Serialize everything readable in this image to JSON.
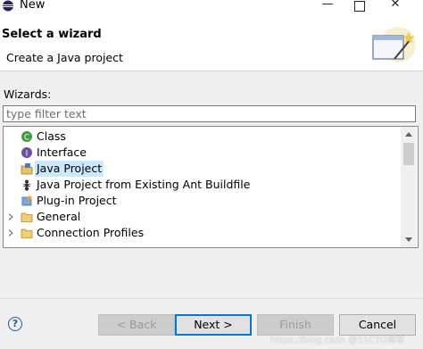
{
  "window": {
    "title": "New"
  },
  "header": {
    "title": "Select a wizard",
    "description": "Create a Java project"
  },
  "filter": {
    "label": "Wizards:",
    "placeholder": "type filter text"
  },
  "tree": {
    "items": [
      {
        "label": "Class",
        "icon": "class-icon",
        "expandable": false,
        "selected": false
      },
      {
        "label": "Interface",
        "icon": "interface-icon",
        "expandable": false,
        "selected": false
      },
      {
        "label": "Java Project",
        "icon": "java-project-icon",
        "expandable": false,
        "selected": true
      },
      {
        "label": "Java Project from Existing Ant Buildfile",
        "icon": "ant-icon",
        "expandable": false,
        "selected": false
      },
      {
        "label": "Plug-in Project",
        "icon": "plugin-project-icon",
        "expandable": false,
        "selected": false
      },
      {
        "label": "General",
        "icon": "folder-icon",
        "expandable": true,
        "selected": false
      },
      {
        "label": "Connection Profiles",
        "icon": "folder-icon",
        "expandable": true,
        "selected": false
      }
    ]
  },
  "footer": {
    "help_label": "?",
    "back_label": "< Back",
    "next_label": "Next >",
    "finish_label": "Finish",
    "cancel_label": "Cancel"
  },
  "watermark": "https://blog.csdn @51CTO博客",
  "colors": {
    "selection": "#cce8ff",
    "default_button_border": "#0078d7",
    "help_icon": "#1e5aa8"
  }
}
